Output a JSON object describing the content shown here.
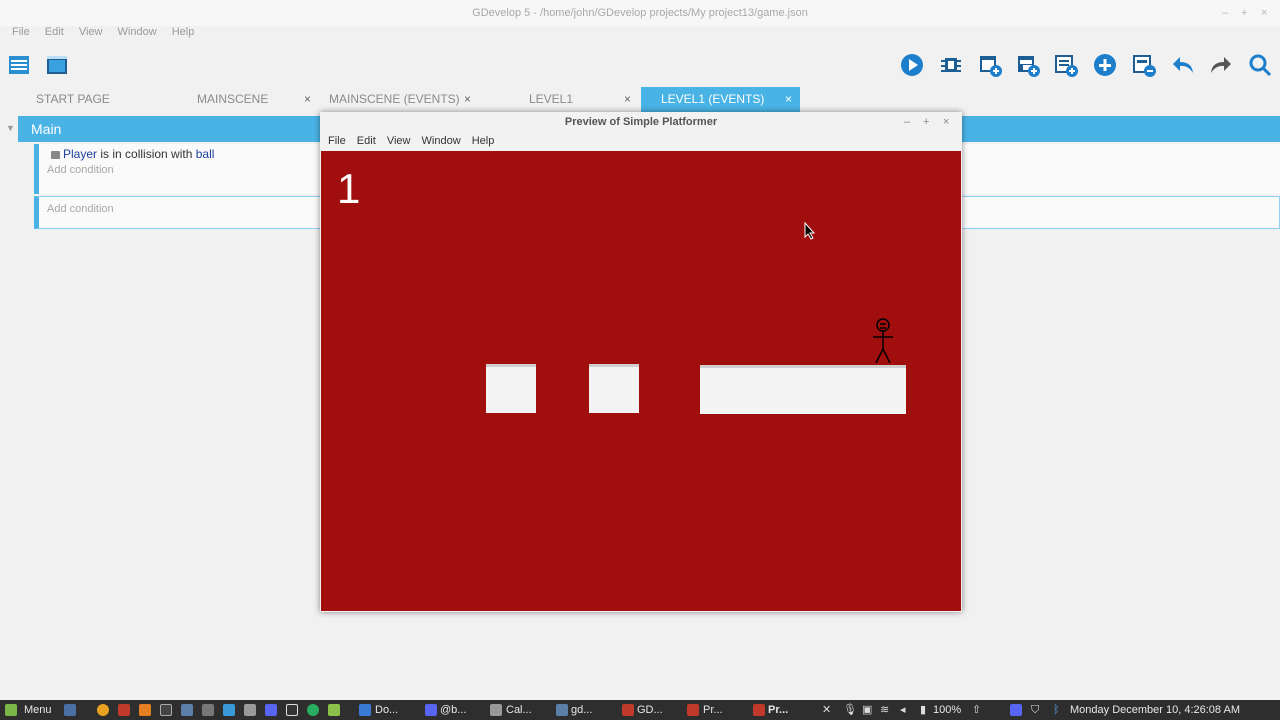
{
  "window": {
    "title": "GDevelop 5 - /home/john/GDevelop projects/My project13/game.json",
    "minimize": "–",
    "maximize": "+",
    "close": "×"
  },
  "menu": [
    "File",
    "Edit",
    "View",
    "Window",
    "Help"
  ],
  "toolbar_icons": [
    "project-manager-icon",
    "scene-editor-icon",
    "preview-icon",
    "debugger-icon",
    "add-event-icon",
    "add-subevent-icon",
    "add-comment-icon",
    "add-other-icon",
    "delete-icon",
    "undo-icon",
    "redo-icon",
    "search-icon"
  ],
  "tabs": [
    {
      "label": "START PAGE",
      "closable": false
    },
    {
      "label": "MAINSCENE",
      "closable": true
    },
    {
      "label": "MAINSCENE (EVENTS)",
      "closable": true
    },
    {
      "label": "LEVEL1",
      "closable": true
    },
    {
      "label": "LEVEL1 (EVENTS)",
      "closable": true,
      "active": true
    }
  ],
  "close_glyph": "×",
  "events": {
    "group": "Main",
    "condition": {
      "object": "Player",
      "text": " is in collision with ",
      "target": "ball"
    },
    "add_condition": "Add condition"
  },
  "preview": {
    "title": "Preview of Simple Platformer",
    "menu": [
      "File",
      "Edit",
      "View",
      "Window",
      "Help"
    ],
    "score": "1",
    "controls": {
      "minimize": "–",
      "maximize": "+",
      "close": "×"
    }
  },
  "taskbar": {
    "menu_label": "Menu",
    "tasks": [
      "Do...",
      "@b...",
      "Cal...",
      "gd...",
      "GD...",
      "Pr...",
      "Pr..."
    ],
    "battery": "100%",
    "clock": "Monday December 10,  4:26:08 AM"
  },
  "colors": {
    "accent": "#4ab3e6",
    "game_background": "#a10e0e",
    "platform": "#f4f4f4"
  }
}
